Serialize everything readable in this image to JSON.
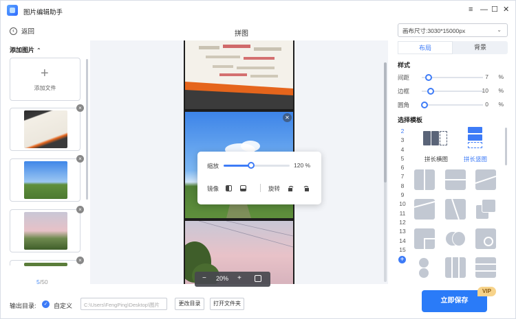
{
  "app": {
    "title": "图片编辑助手",
    "window_controls": [
      "≡",
      "—",
      "☐",
      "✕"
    ]
  },
  "header": {
    "back_label": "返回",
    "page_title": "拼图"
  },
  "left": {
    "section_label": "添加图片",
    "add_file_label": "添加文件",
    "count_current": "5",
    "count_total": "/50"
  },
  "canvas": {
    "zoom_label": "缩放",
    "zoom_value": "120 %",
    "zoom_level": 0.42,
    "mirror_label": "镜像",
    "rotate_label": "旋转",
    "view_zoom": "20%",
    "zoom_out": "−",
    "zoom_in": "+"
  },
  "right": {
    "canvas_size": "画布尺寸:3030*15000px",
    "tabs": [
      "布局",
      "背景"
    ],
    "style_title": "样式",
    "sliders": [
      {
        "name": "间距",
        "value": "7",
        "unit": "%",
        "level": 0.07
      },
      {
        "name": "边框",
        "value": "10",
        "unit": "%",
        "level": 0.1
      },
      {
        "name": "圆角",
        "value": "0",
        "unit": "%",
        "level": 0
      }
    ],
    "template_title": "选择模板",
    "template_counts": [
      "2",
      "3",
      "4",
      "5",
      "6",
      "7",
      "8",
      "9",
      "10",
      "11",
      "12",
      "13",
      "14",
      "15"
    ],
    "big_templates": [
      "拼长横图",
      "拼长竖图"
    ]
  },
  "bottom": {
    "output_label": "输出目录:",
    "custom_label": "自定义",
    "path": "C:\\Users\\FengPing\\Desktop\\图片",
    "change_dir": "更改目录",
    "open_folder": "打开文件夹",
    "save_label": "立即保存",
    "vip_label": "VIP"
  },
  "colors": {
    "accent": "#2a7bf8",
    "canvas_bg": "#f2f4f8",
    "vip": "#f7d38a"
  }
}
